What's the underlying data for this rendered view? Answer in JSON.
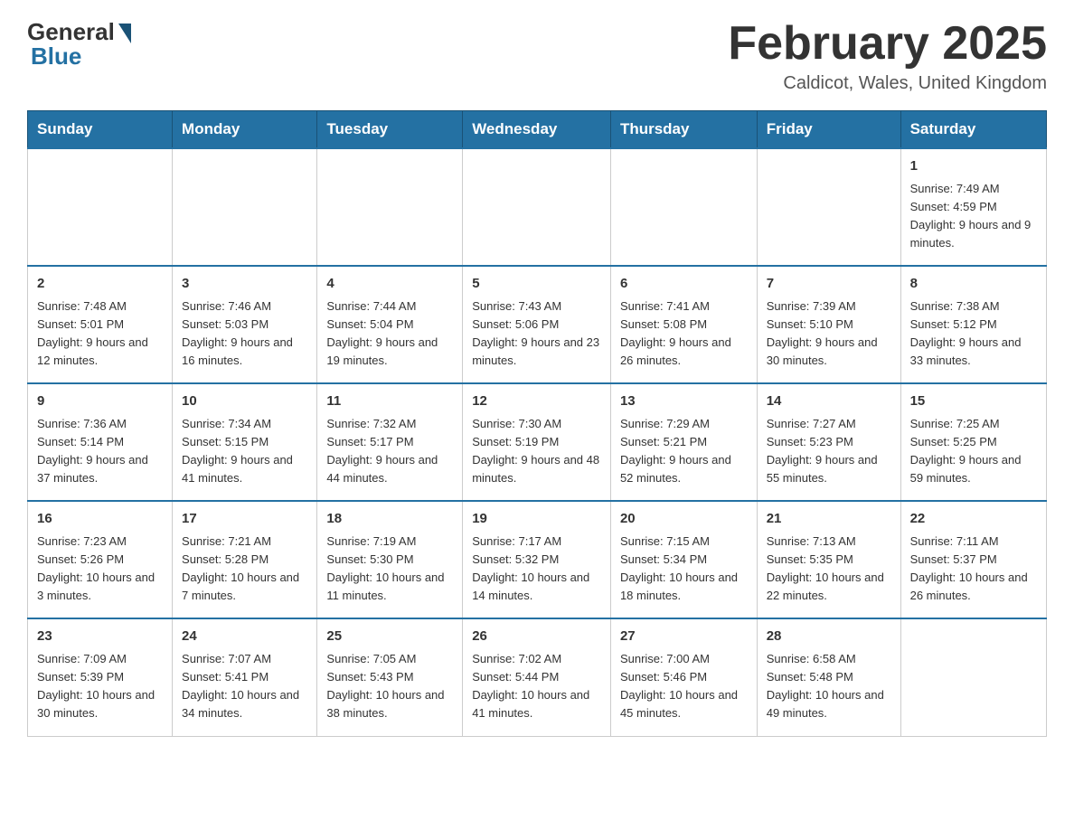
{
  "header": {
    "logo_general": "General",
    "logo_blue": "Blue",
    "month_title": "February 2025",
    "location": "Caldicot, Wales, United Kingdom"
  },
  "weekdays": [
    "Sunday",
    "Monday",
    "Tuesday",
    "Wednesday",
    "Thursday",
    "Friday",
    "Saturday"
  ],
  "weeks": [
    [
      {
        "day": "",
        "info": ""
      },
      {
        "day": "",
        "info": ""
      },
      {
        "day": "",
        "info": ""
      },
      {
        "day": "",
        "info": ""
      },
      {
        "day": "",
        "info": ""
      },
      {
        "day": "",
        "info": ""
      },
      {
        "day": "1",
        "info": "Sunrise: 7:49 AM\nSunset: 4:59 PM\nDaylight: 9 hours and 9 minutes."
      }
    ],
    [
      {
        "day": "2",
        "info": "Sunrise: 7:48 AM\nSunset: 5:01 PM\nDaylight: 9 hours and 12 minutes."
      },
      {
        "day": "3",
        "info": "Sunrise: 7:46 AM\nSunset: 5:03 PM\nDaylight: 9 hours and 16 minutes."
      },
      {
        "day": "4",
        "info": "Sunrise: 7:44 AM\nSunset: 5:04 PM\nDaylight: 9 hours and 19 minutes."
      },
      {
        "day": "5",
        "info": "Sunrise: 7:43 AM\nSunset: 5:06 PM\nDaylight: 9 hours and 23 minutes."
      },
      {
        "day": "6",
        "info": "Sunrise: 7:41 AM\nSunset: 5:08 PM\nDaylight: 9 hours and 26 minutes."
      },
      {
        "day": "7",
        "info": "Sunrise: 7:39 AM\nSunset: 5:10 PM\nDaylight: 9 hours and 30 minutes."
      },
      {
        "day": "8",
        "info": "Sunrise: 7:38 AM\nSunset: 5:12 PM\nDaylight: 9 hours and 33 minutes."
      }
    ],
    [
      {
        "day": "9",
        "info": "Sunrise: 7:36 AM\nSunset: 5:14 PM\nDaylight: 9 hours and 37 minutes."
      },
      {
        "day": "10",
        "info": "Sunrise: 7:34 AM\nSunset: 5:15 PM\nDaylight: 9 hours and 41 minutes."
      },
      {
        "day": "11",
        "info": "Sunrise: 7:32 AM\nSunset: 5:17 PM\nDaylight: 9 hours and 44 minutes."
      },
      {
        "day": "12",
        "info": "Sunrise: 7:30 AM\nSunset: 5:19 PM\nDaylight: 9 hours and 48 minutes."
      },
      {
        "day": "13",
        "info": "Sunrise: 7:29 AM\nSunset: 5:21 PM\nDaylight: 9 hours and 52 minutes."
      },
      {
        "day": "14",
        "info": "Sunrise: 7:27 AM\nSunset: 5:23 PM\nDaylight: 9 hours and 55 minutes."
      },
      {
        "day": "15",
        "info": "Sunrise: 7:25 AM\nSunset: 5:25 PM\nDaylight: 9 hours and 59 minutes."
      }
    ],
    [
      {
        "day": "16",
        "info": "Sunrise: 7:23 AM\nSunset: 5:26 PM\nDaylight: 10 hours and 3 minutes."
      },
      {
        "day": "17",
        "info": "Sunrise: 7:21 AM\nSunset: 5:28 PM\nDaylight: 10 hours and 7 minutes."
      },
      {
        "day": "18",
        "info": "Sunrise: 7:19 AM\nSunset: 5:30 PM\nDaylight: 10 hours and 11 minutes."
      },
      {
        "day": "19",
        "info": "Sunrise: 7:17 AM\nSunset: 5:32 PM\nDaylight: 10 hours and 14 minutes."
      },
      {
        "day": "20",
        "info": "Sunrise: 7:15 AM\nSunset: 5:34 PM\nDaylight: 10 hours and 18 minutes."
      },
      {
        "day": "21",
        "info": "Sunrise: 7:13 AM\nSunset: 5:35 PM\nDaylight: 10 hours and 22 minutes."
      },
      {
        "day": "22",
        "info": "Sunrise: 7:11 AM\nSunset: 5:37 PM\nDaylight: 10 hours and 26 minutes."
      }
    ],
    [
      {
        "day": "23",
        "info": "Sunrise: 7:09 AM\nSunset: 5:39 PM\nDaylight: 10 hours and 30 minutes."
      },
      {
        "day": "24",
        "info": "Sunrise: 7:07 AM\nSunset: 5:41 PM\nDaylight: 10 hours and 34 minutes."
      },
      {
        "day": "25",
        "info": "Sunrise: 7:05 AM\nSunset: 5:43 PM\nDaylight: 10 hours and 38 minutes."
      },
      {
        "day": "26",
        "info": "Sunrise: 7:02 AM\nSunset: 5:44 PM\nDaylight: 10 hours and 41 minutes."
      },
      {
        "day": "27",
        "info": "Sunrise: 7:00 AM\nSunset: 5:46 PM\nDaylight: 10 hours and 45 minutes."
      },
      {
        "day": "28",
        "info": "Sunrise: 6:58 AM\nSunset: 5:48 PM\nDaylight: 10 hours and 49 minutes."
      },
      {
        "day": "",
        "info": ""
      }
    ]
  ]
}
